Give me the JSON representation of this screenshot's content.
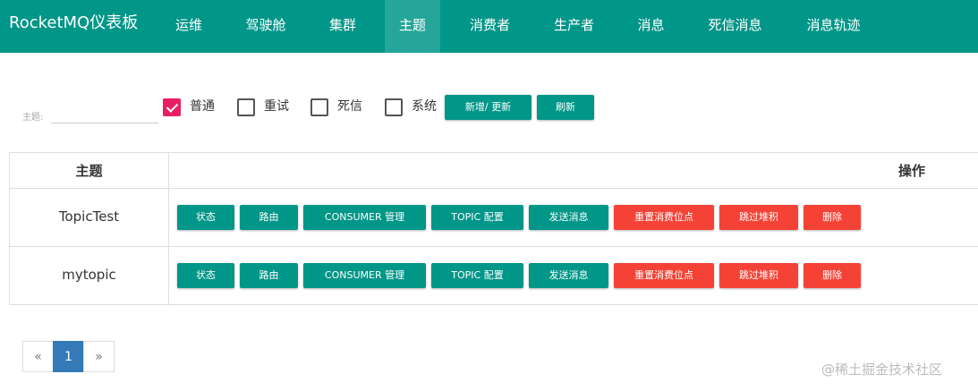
{
  "app": {
    "brand": "RocketMQ仪表板"
  },
  "nav": {
    "items": [
      {
        "label": "运维",
        "active": false
      },
      {
        "label": "驾驶舱",
        "active": false
      },
      {
        "label": "集群",
        "active": false
      },
      {
        "label": "主题",
        "active": true
      },
      {
        "label": "消费者",
        "active": false
      },
      {
        "label": "生产者",
        "active": false
      },
      {
        "label": "消息",
        "active": false
      },
      {
        "label": "死信消息",
        "active": false
      },
      {
        "label": "消息轨迹",
        "active": false
      }
    ]
  },
  "filter": {
    "topic_label": "主题:",
    "topic_value": "",
    "checkboxes": [
      {
        "label": "普通",
        "checked": true
      },
      {
        "label": "重试",
        "checked": false
      },
      {
        "label": "死信",
        "checked": false
      },
      {
        "label": "系统",
        "checked": false
      }
    ],
    "add_update_label": "新增/ 更新",
    "refresh_label": "刷新"
  },
  "table": {
    "headers": {
      "topic": "主题",
      "operation": "操作"
    },
    "rows": [
      {
        "topic": "TopicTest"
      },
      {
        "topic": "mytopic"
      }
    ],
    "actions": [
      {
        "label": "状态",
        "style": "teal"
      },
      {
        "label": "路由",
        "style": "teal"
      },
      {
        "label": "CONSUMER 管理",
        "style": "teal"
      },
      {
        "label": "TOPIC 配置",
        "style": "teal"
      },
      {
        "label": "发送消息",
        "style": "teal"
      },
      {
        "label": "重置消费位点",
        "style": "red"
      },
      {
        "label": "跳过堆积",
        "style": "red"
      },
      {
        "label": "删除",
        "style": "red"
      }
    ]
  },
  "pagination": {
    "prev": "«",
    "current": "1",
    "next": "»"
  },
  "watermark": "@稀土掘金技术社区",
  "colors": {
    "primary": "#009688",
    "primary_active": "#26a69a",
    "danger": "#f44336",
    "checkbox": "#e91e63",
    "page_active": "#337ab7"
  }
}
